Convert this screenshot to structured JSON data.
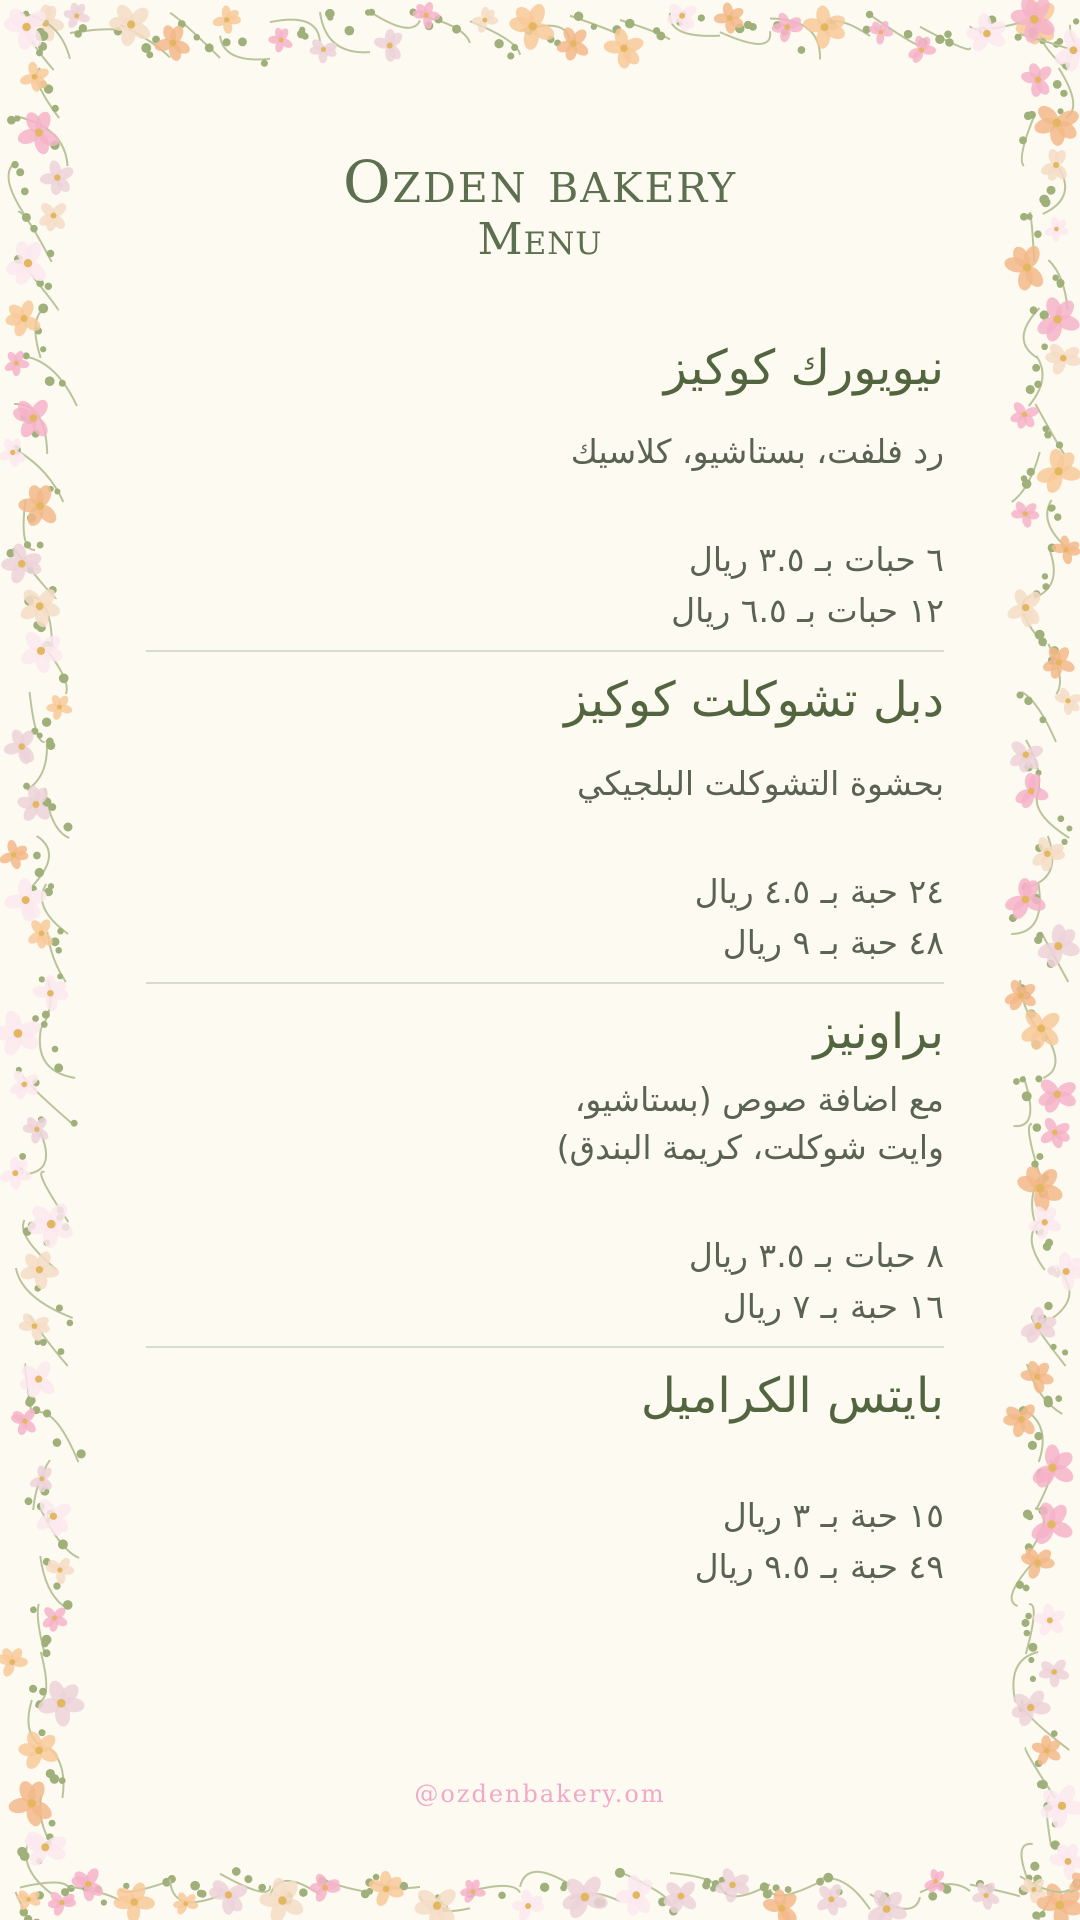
{
  "header": {
    "title": "Ozden bakery",
    "subtitle": "Menu"
  },
  "items": [
    {
      "name": "نيويورك كوكيز",
      "description": "رد فلفت، بستاشيو، كلاسيك",
      "prices": [
        "٦ حبات بـ ٣.٥ ريال",
        "١٢ حبات بـ ٦.٥ ريال"
      ]
    },
    {
      "name": "دبل تشوكلت كوكيز",
      "description": "بحشوة التشوكلت البلجيكي",
      "prices": [
        "٢٤ حبة بـ ٤.٥ ريال",
        "٤٨ حبة بـ ٩ ريال"
      ]
    },
    {
      "name": "براونيز",
      "description_lines": [
        "مع اضافة صوص (بستاشيو،",
        "وايت شوكلت، كريمة البندق)"
      ],
      "prices": [
        "٨ حبات بـ ٣.٥ ريال",
        "١٦ حبة بـ ٧ ريال"
      ]
    },
    {
      "name": "بايتس الكراميل",
      "prices": [
        "١٥ حبة بـ ٣ ريال",
        "٤٩ حبة بـ ٩.٥ ريال"
      ]
    }
  ],
  "footer": {
    "handle": "@ozdenbakery.om"
  },
  "colors": {
    "background": "#fdfaf2",
    "title": "#5c6f4e",
    "text": "#5a6352",
    "divider": "#d6dbd0",
    "footer": "#f2a9c8"
  }
}
